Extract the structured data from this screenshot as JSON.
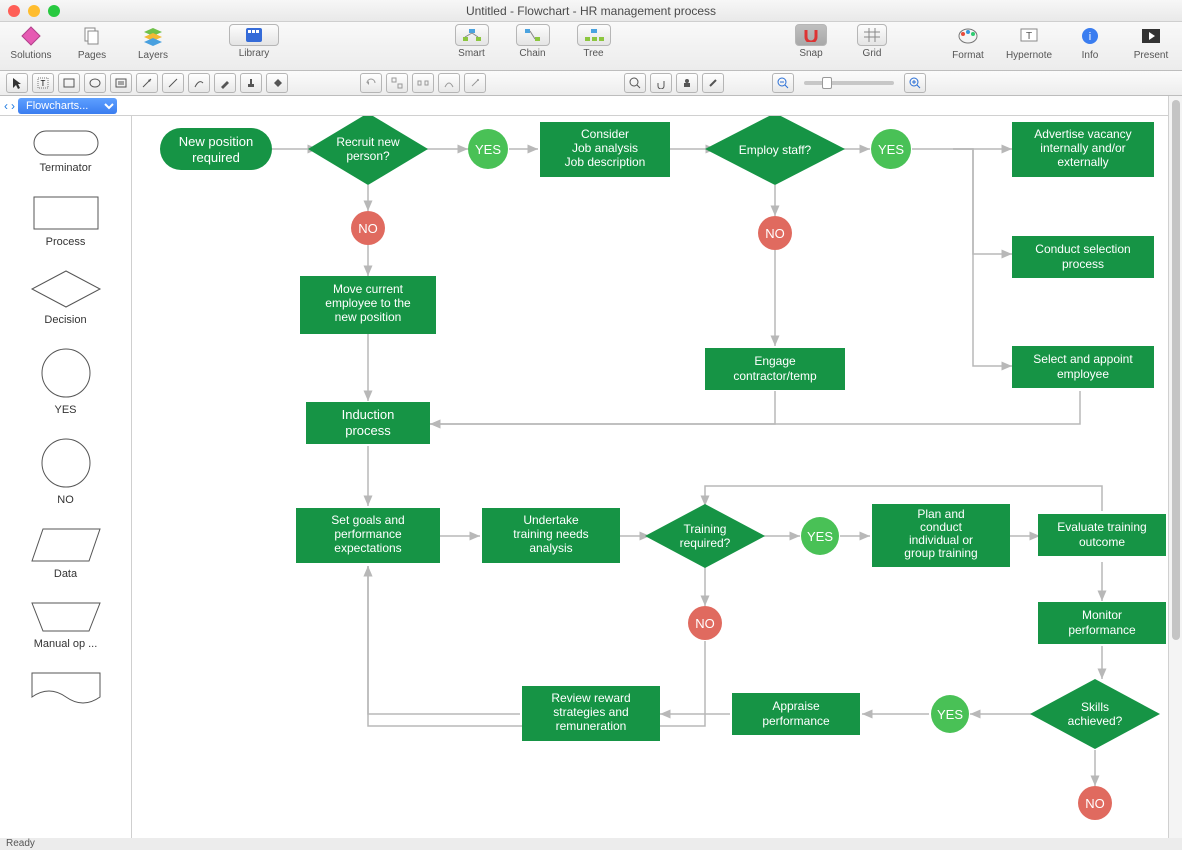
{
  "window": {
    "title": "Untitled - Flowchart - HR management process"
  },
  "toolbar": {
    "solutions": "Solutions",
    "pages": "Pages",
    "layers": "Layers",
    "library": "Library",
    "smart": "Smart",
    "chain": "Chain",
    "tree": "Tree",
    "snap": "Snap",
    "grid": "Grid",
    "format": "Format",
    "hypernote": "Hypernote",
    "info": "Info",
    "present": "Present"
  },
  "nav": {
    "library_selector": "Flowcharts...",
    "back": "‹",
    "fwd": "›"
  },
  "palette": [
    {
      "label": "Terminator"
    },
    {
      "label": "Process"
    },
    {
      "label": "Decision"
    },
    {
      "label": "YES"
    },
    {
      "label": "NO"
    },
    {
      "label": "Data"
    },
    {
      "label": "Manual op ..."
    },
    {
      "label": ""
    }
  ],
  "flow": {
    "new_position": "New position\nrequired",
    "recruit": "Recruit new\nperson?",
    "yes": "YES",
    "no": "NO",
    "consider": "Consider\nJob analysis\nJob description",
    "employ": "Employ staff?",
    "advertise": "Advertise vacancy\ninternally and/or\nexternally",
    "conduct_sel": "Conduct selection\nprocess",
    "select_appoint": "Select and appoint\nemployee",
    "engage": "Engage\ncontractor/temp",
    "move": "Move current\nemployee to the\nnew position",
    "induction": "Induction\nprocess",
    "setgoals": "Set goals and\nperformance\nexpectations",
    "undertake": "Undertake\ntraining needs\nanalysis",
    "training": "Training\nrequired?",
    "plan": "Plan and\nconduct\nindividual or\ngroup training",
    "evaluate": "Evaluate training\noutcome",
    "monitor": "Monitor\nperformance",
    "skills": "Skills\nachieved?",
    "appraise": "Appraise\nperformance",
    "review": "Review reward\nstrategies and\nremuneration"
  },
  "colors": {
    "green": "#169445",
    "lightgreen": "#49c156",
    "red": "#e06a5f"
  },
  "zoom": "100%",
  "status": "Ready"
}
